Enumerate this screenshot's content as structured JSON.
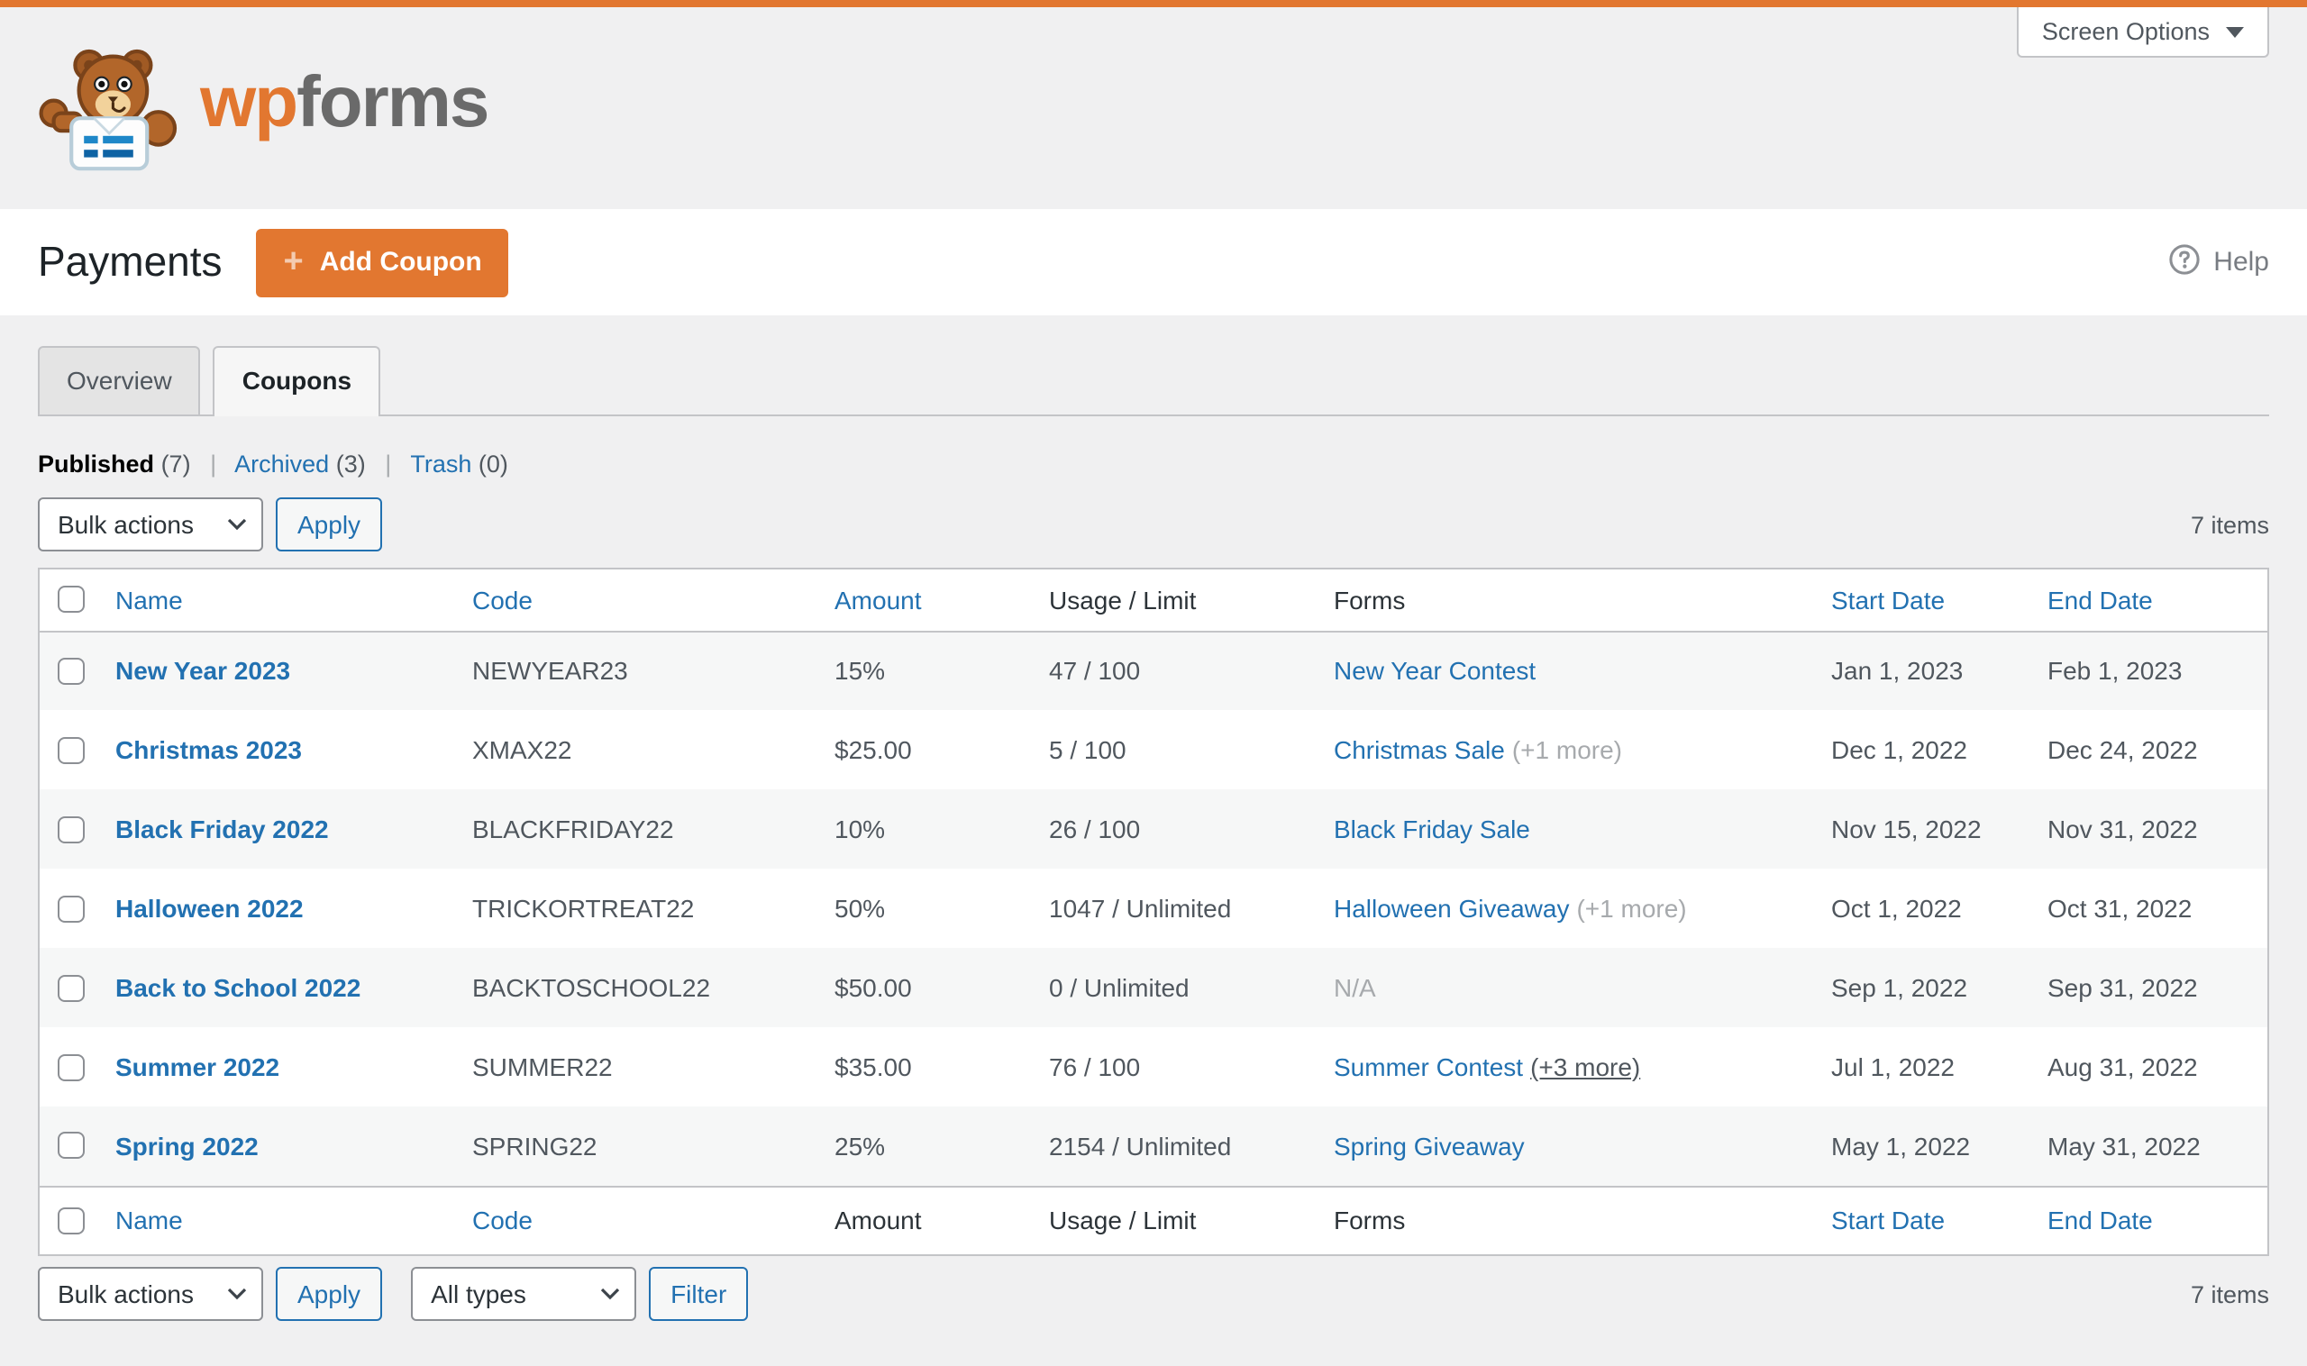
{
  "screen_options": {
    "label": "Screen Options"
  },
  "brand": {
    "wp": "wp",
    "forms": "forms",
    "logo": "wpforms-bear-mascot"
  },
  "page": {
    "title": "Payments",
    "add_coupon": "Add Coupon",
    "plus": "+",
    "help": "Help"
  },
  "tabs": {
    "overview": "Overview",
    "coupons": "Coupons"
  },
  "views": {
    "published": "Published",
    "published_count": "(7)",
    "archived": "Archived",
    "archived_count": "(3)",
    "trash": "Trash",
    "trash_count": "(0)",
    "separator": "|"
  },
  "toolbar": {
    "bulk_actions": "Bulk actions",
    "apply": "Apply",
    "all_types": "All types",
    "filter": "Filter",
    "items": "7 items"
  },
  "columns": {
    "name": "Name",
    "code": "Code",
    "amount": "Amount",
    "usage": "Usage / Limit",
    "forms": "Forms",
    "start": "Start Date",
    "end": "End Date"
  },
  "rows": [
    {
      "name": "New Year 2023",
      "code": "NEWYEAR23",
      "amount": "15%",
      "usage": "47 / 100",
      "forms": "New Year Contest",
      "start": "Jan 1, 2023",
      "end": "Feb 1, 2023"
    },
    {
      "name": "Christmas 2023",
      "code": "XMAX22",
      "amount": "$25.00",
      "usage": "5 / 100",
      "forms": "Christmas Sale",
      "forms_extra": "(+1 more)",
      "start": "Dec 1, 2022",
      "end": "Dec 24, 2022"
    },
    {
      "name": "Black Friday 2022",
      "code": "BLACKFRIDAY22",
      "amount": "10%",
      "usage": "26 / 100",
      "forms": "Black Friday Sale",
      "start": "Nov 15, 2022",
      "end": "Nov 31, 2022"
    },
    {
      "name": "Halloween 2022",
      "code": "TRICKORTREAT22",
      "amount": "50%",
      "usage": "1047 / Unlimited",
      "forms": "Halloween Giveaway",
      "forms_extra": "(+1 more)",
      "start": "Oct 1, 2022",
      "end": "Oct 31, 2022"
    },
    {
      "name": "Back to School 2022",
      "code": "BACKTOSCHOOL22",
      "amount": "$50.00",
      "usage": "0 / Unlimited",
      "forms": "N/A",
      "start": "Sep 1, 2022",
      "end": "Sep 31, 2022"
    },
    {
      "name": "Summer 2022",
      "code": "SUMMER22",
      "amount": "$35.00",
      "usage": "76 / 100",
      "forms": "Summer Contest",
      "forms_extra": "(+3 more)",
      "start": "Jul 1, 2022",
      "end": "Aug 31, 2022"
    },
    {
      "name": "Spring 2022",
      "code": "SPRING22",
      "amount": "25%",
      "usage": "2154 / Unlimited",
      "forms": "Spring Giveaway",
      "start": "May 1, 2022",
      "end": "May 31, 2022"
    }
  ],
  "colors": {
    "brand_orange": "#e27730",
    "link_blue": "#2271b1",
    "page_bg": "#f0f0f1",
    "border": "#c3c4c7",
    "muted_gray": "#a7aaad"
  }
}
